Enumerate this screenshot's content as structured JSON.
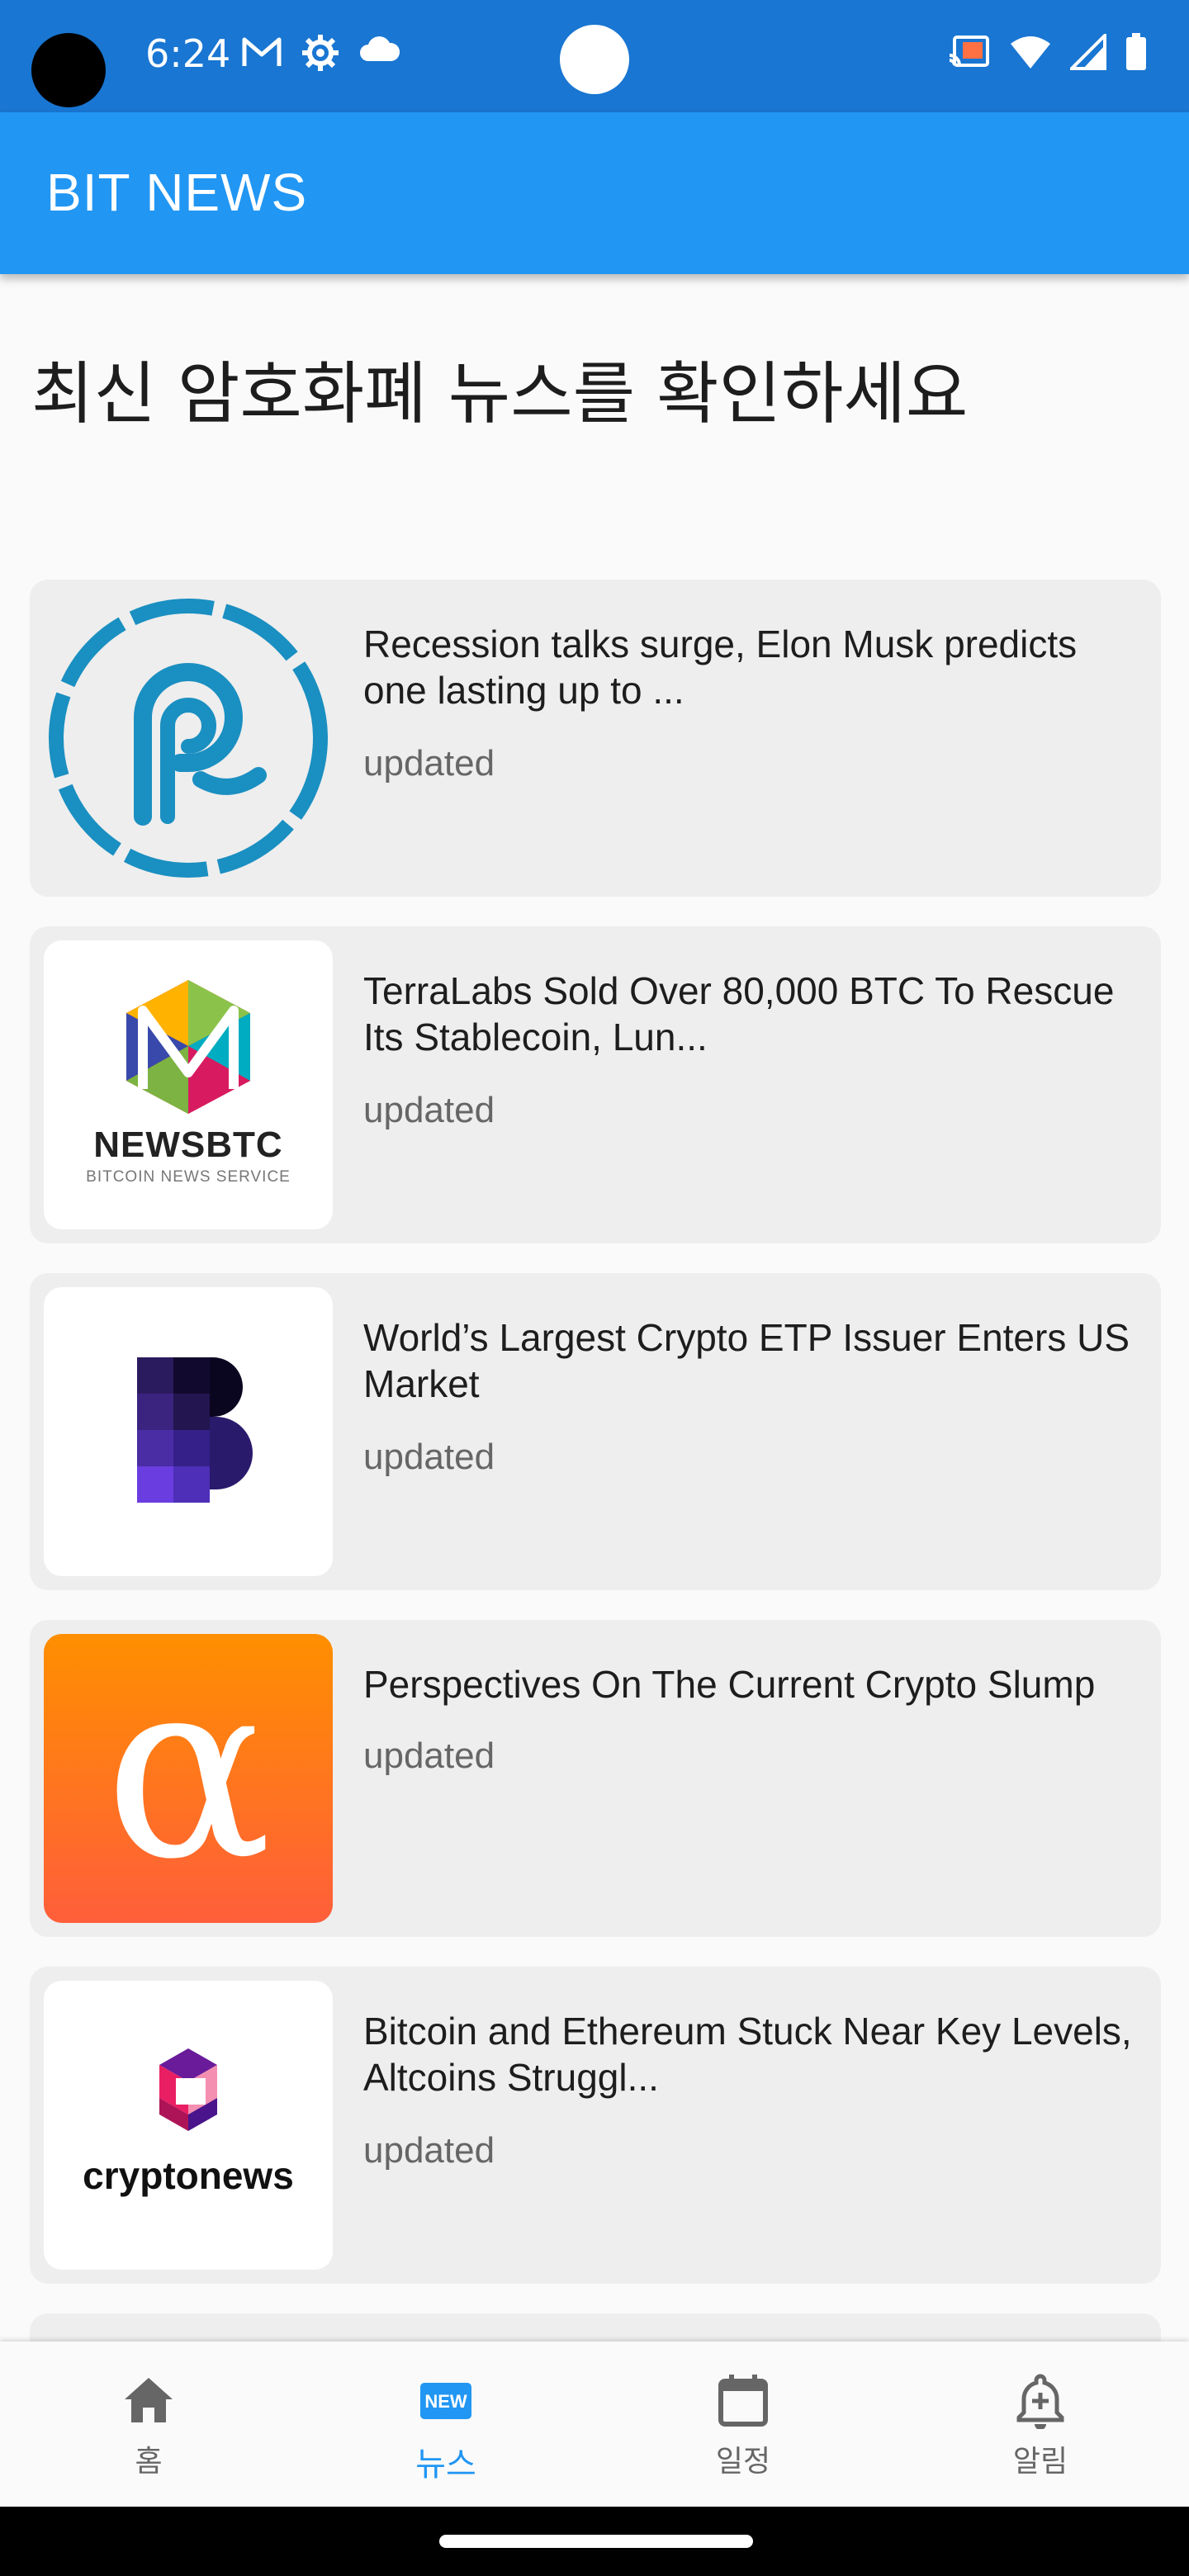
{
  "status_bar": {
    "time": "6:24",
    "left_icons": [
      "gmail-icon",
      "settings-icon",
      "cloud-icon"
    ],
    "right_icons": [
      "cast-icon",
      "wifi-icon",
      "signal-icon",
      "battery-icon"
    ]
  },
  "app_bar": {
    "title": "BIT NEWS",
    "color": "#2196f3"
  },
  "page": {
    "heading": "최신 암호화폐 뉴스를 확인하세요"
  },
  "news": [
    {
      "title": "Recession talks surge, Elon Musk predicts one lasting up to ...",
      "status": "updated",
      "source_logo": "coinpedia-logo"
    },
    {
      "title": "TerraLabs Sold Over 80,000 BTC To Rescue Its Stablecoin, Lun...",
      "status": "updated",
      "source_logo": "newsbtc-logo",
      "logo_text": "NEWSBTC",
      "logo_subtext": "BITCOIN NEWS SERVICE"
    },
    {
      "title": "World’s Largest Crypto ETP Issuer Enters US Market",
      "status": "updated",
      "source_logo": "b-logo"
    },
    {
      "title": " Perspectives On The Current Crypto Slump",
      "status": "updated",
      "source_logo": "alpha-logo",
      "logo_text": "α"
    },
    {
      "title": "Bitcoin and Ethereum Stuck Near Key Levels, Altcoins Struggl...",
      "status": "updated",
      "source_logo": "cryptonews-logo",
      "logo_text": "cryptonews"
    }
  ],
  "bottom_nav": {
    "items": [
      {
        "label": "홈",
        "icon": "home-icon",
        "active": false
      },
      {
        "label": "뉴스",
        "icon": "news-icon",
        "icon_text": "NEW",
        "active": true
      },
      {
        "label": "일정",
        "icon": "calendar-icon",
        "active": false
      },
      {
        "label": "알림",
        "icon": "bell-add-icon",
        "active": false
      }
    ],
    "active_color": "#2196f3"
  }
}
